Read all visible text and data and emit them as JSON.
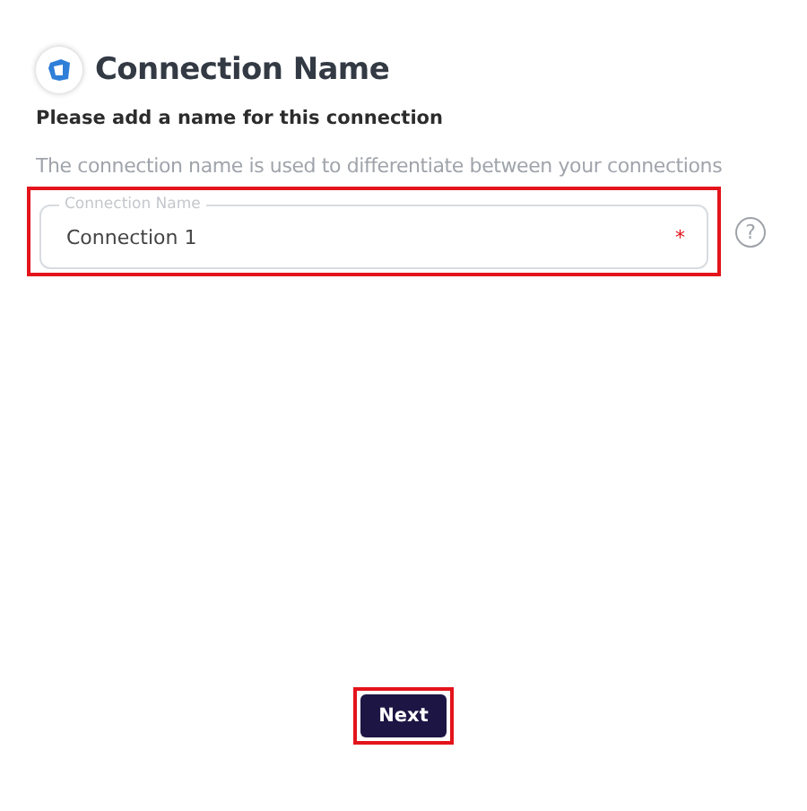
{
  "header": {
    "title": "Connection Name"
  },
  "subtitle": "Please add a name for this connection",
  "description": "The connection name is used to differentiate between your connections",
  "field": {
    "label": "Connection Name",
    "value": "Connection 1",
    "required_mark": "*",
    "highlighted": true,
    "help": "?"
  },
  "button": {
    "label": "Next",
    "highlighted": true
  }
}
